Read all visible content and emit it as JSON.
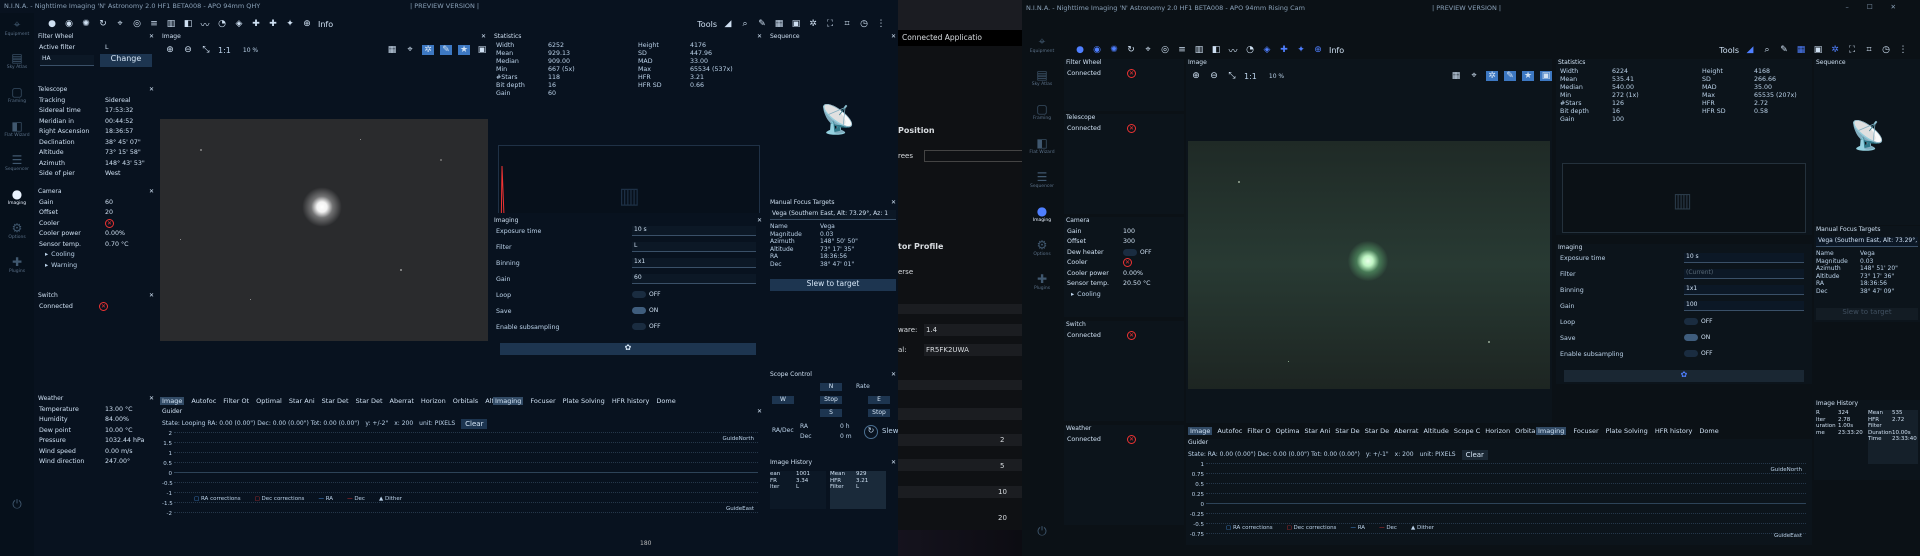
{
  "win1": {
    "title": "N.I.N.A. - Nighttime Imaging 'N' Astronomy 2.0 HF1 BETA008  -  APO 94mm QHY",
    "preview": "| PREVIEW VERSION |",
    "tools": "Tools",
    "info": "Info",
    "nav": [
      "Equipment",
      "Sky Atlas",
      "Framing",
      "Flat Wizard",
      "Sequencer",
      "Imaging",
      "Options",
      "Plugins"
    ],
    "filterwheel": {
      "title": "Filter Wheel",
      "active_label": "Active filter",
      "active_value": "L",
      "select": "HA",
      "change": "Change"
    },
    "telescope": {
      "title": "Telescope",
      "rows": [
        [
          "Tracking",
          "Sidereal"
        ],
        [
          "Sidereal time",
          "17:53:32"
        ],
        [
          "Meridian in",
          "00:44:52"
        ],
        [
          "Right Ascension",
          "18:36:57"
        ],
        [
          "Declination",
          "38° 45' 07\""
        ],
        [
          "Altitude",
          "73° 15' 58\""
        ],
        [
          "Azimuth",
          "148° 43' 53\""
        ],
        [
          "Side of pier",
          "West"
        ]
      ]
    },
    "camera": {
      "title": "Camera",
      "rows": [
        [
          "Gain",
          "60"
        ],
        [
          "Offset",
          "20"
        ],
        [
          "Cooler",
          ""
        ],
        [
          "Cooler power",
          "0.00%"
        ],
        [
          "Sensor temp.",
          "0.70 °C"
        ]
      ],
      "sub1": "Cooling",
      "sub2": "Warning"
    },
    "switch": {
      "title": "Switch",
      "connected": "Connected"
    },
    "weather": {
      "title": "Weather",
      "rows": [
        [
          "Temperature",
          "13.00 °C"
        ],
        [
          "Humidity",
          "84.00%"
        ],
        [
          "Dew point",
          "10.00 °C"
        ],
        [
          "Pressure",
          "1032.44 hPa"
        ],
        [
          "Wind speed",
          "0.00 m/s"
        ],
        [
          "Wind direction",
          "247.00°"
        ]
      ]
    },
    "image": {
      "title": "Image",
      "zoom": "10 %",
      "fit": "1:1"
    },
    "stats": {
      "title": "Statistics",
      "cells": [
        "Width",
        "6252",
        "Height",
        "4176",
        "Mean",
        "929.13",
        "SD",
        "447.96",
        "Median",
        "909.00",
        "MAD",
        "33.00",
        "Min",
        "667 (5x)",
        "Max",
        "65534 (537x)",
        "#Stars",
        "118",
        "HFR",
        "3.21",
        "Bit depth",
        "16",
        "HFR SD",
        "0.66",
        "Gain",
        "60",
        "",
        ""
      ]
    },
    "imaging": {
      "title": "Imaging",
      "rows": [
        [
          "Exposure time",
          "10 s"
        ],
        [
          "Filter",
          "L"
        ],
        [
          "Binning",
          "1x1"
        ],
        [
          "Gain",
          "60"
        ]
      ],
      "loop": [
        "Loop",
        "OFF"
      ],
      "save": [
        "Save",
        "ON"
      ],
      "sub": [
        "Enable subsampling",
        "OFF"
      ]
    },
    "sequence": {
      "title": "Sequence"
    },
    "mft": {
      "title": "Manual Focus Targets",
      "select": "Vega (Southern East, Alt: 73.29°, Az: 1",
      "rows": [
        [
          "Name",
          "Vega"
        ],
        [
          "Magnitude",
          "0.03"
        ],
        [
          "Azimuth",
          "148° 50' 50\""
        ],
        [
          "Altitude",
          "73° 17' 35\""
        ],
        [
          "RA",
          "18:36:56"
        ],
        [
          "Dec",
          "38° 47' 01\""
        ]
      ],
      "slew": "Slew to target"
    },
    "scope": {
      "title": "Scope Control",
      "n": "N",
      "rate": "Rate",
      "w": "W",
      "stop": "Stop",
      "e": "E",
      "s": "S",
      "radec": "RA/Dec",
      "ra": "RA",
      "dec": "Dec",
      "h": "0 h",
      "m": "0 m",
      "slew": "Slew"
    },
    "history": {
      "title": "Image History",
      "a": [
        "ean",
        "FR",
        "lter"
      ],
      "av": [
        "1001",
        "3.34",
        "L"
      ],
      "b": [
        "Mean",
        "HFR",
        "Filter"
      ],
      "bv": [
        "929",
        "3.21",
        "L"
      ]
    },
    "tabs_left": [
      "Image",
      "Autofoc",
      "Filter Ot",
      "Optimal",
      "Star Ani",
      "Star Det",
      "Star Det",
      "Aberrat",
      "Horizon",
      "Orbitals",
      "Altitude"
    ],
    "tabs_right": [
      "Imaging",
      "Focuser",
      "Plate Solving",
      "HFR history",
      "Dome"
    ],
    "guider": {
      "title": "Guider",
      "state": "State: Looping  RA: 0.00 (0.00\")  Dec: 0.00 (0.00\")  Tot: 0.00 (0.00\")",
      "y": "y: +/-2\"",
      "x": "x: 200",
      "unit": "unit: PIXELS",
      "clear": "Clear",
      "north": "GuideNorth",
      "east": "GuideEast",
      "yticks": [
        "2",
        "1.5",
        "1",
        "0.5",
        "0",
        "-0.5",
        "-1",
        "-1.5",
        "-2"
      ],
      "legend": [
        "RA corrections",
        "Dec corrections",
        "RA",
        "Dec",
        "Dither"
      ]
    }
  },
  "middle": {
    "title": "Connected Applicatio",
    "position": "Position",
    "degrees": "rees",
    "profile": "tor Profile",
    "verse": "erse",
    "ware_k": "ware:",
    "ware_v": "1.4",
    "al_k": "al:",
    "al_v": "FR5FK2UWA",
    "nums": [
      "2",
      "5",
      "10",
      "20"
    ],
    "bottom": "180"
  },
  "win2": {
    "title": "N.I.N.A. - Nighttime Imaging 'N' Astronomy 2.0 HF1 BETA008  -  APO 94mm Rising Cam",
    "preview": "| PREVIEW VERSION |",
    "tools": "Tools",
    "info": "Info",
    "nav": [
      "Equipment",
      "Sky Atlas",
      "Framing",
      "Flat Wizard",
      "Sequencer",
      "Imaging",
      "Options",
      "Plugins"
    ],
    "filterwheel": {
      "title": "Filter Wheel",
      "connected": "Connected"
    },
    "telescope": {
      "title": "Telescope",
      "connected": "Connected"
    },
    "camera": {
      "title": "Camera",
      "rows": [
        [
          "Gain",
          "100"
        ],
        [
          "Offset",
          "300"
        ],
        [
          "Dew heater",
          "OFF"
        ],
        [
          "Cooler",
          ""
        ],
        [
          "Cooler power",
          "0.00%"
        ],
        [
          "Sensor temp.",
          "20.50 °C"
        ]
      ],
      "sub1": "Cooling"
    },
    "switch": {
      "title": "Switch",
      "connected": "Connected"
    },
    "weather": {
      "title": "Weather",
      "connected": "Connected"
    },
    "image": {
      "title": "Image",
      "zoom": "10 %",
      "fit": "1:1"
    },
    "stats": {
      "title": "Statistics",
      "cells": [
        "Width",
        "6224",
        "Height",
        "4168",
        "Mean",
        "535.41",
        "SD",
        "266.66",
        "Median",
        "540.00",
        "MAD",
        "35.00",
        "Min",
        "272 (1x)",
        "Max",
        "65535 (207x)",
        "#Stars",
        "126",
        "HFR",
        "2.72",
        "Bit depth",
        "16",
        "HFR SD",
        "0.58",
        "Gain",
        "100",
        "",
        ""
      ]
    },
    "imaging": {
      "title": "Imaging",
      "rows": [
        [
          "Exposure time",
          "10 s"
        ],
        [
          "Filter",
          "(Current)"
        ],
        [
          "Binning",
          "1x1"
        ],
        [
          "Gain",
          "100"
        ]
      ],
      "loop": [
        "Loop",
        "OFF"
      ],
      "save": [
        "Save",
        "ON"
      ],
      "sub": [
        "Enable subsampling",
        "OFF"
      ]
    },
    "sequence": {
      "title": "Sequence"
    },
    "mft": {
      "title": "Manual Focus Targets",
      "select": "Vega (Southern East, Alt: 73.29°, Az: 1",
      "rows": [
        [
          "Name",
          "Vega"
        ],
        [
          "Magnitude",
          "0.03"
        ],
        [
          "Azimuth",
          "148° 51' 20\""
        ],
        [
          "Altitude",
          "73° 17' 36\""
        ],
        [
          "RA",
          "18:36:56"
        ],
        [
          "Dec",
          "38° 47' 09\""
        ]
      ],
      "slew": "Slew to target"
    },
    "history": {
      "title": "Image History",
      "a": [
        "R",
        "lter",
        "uration",
        "me"
      ],
      "av": [
        "324",
        "2.78",
        "1.00s",
        "23:33:20"
      ],
      "b": [
        "Mean",
        "HFR",
        "Filter",
        "Duration",
        "Time"
      ],
      "bv": [
        "535",
        "2.72",
        "",
        "10.00s",
        "23:33:40"
      ]
    },
    "tabs_left": [
      "Image",
      "Autofoc",
      "Filter O",
      "Optima",
      "Star Ani",
      "Star De",
      "Star De",
      "Aberrat",
      "Altitude",
      "Scope C",
      "Horizon",
      "Orbitals"
    ],
    "tabs_right": [
      "Imaging",
      "Focuser",
      "Plate Solving",
      "HFR history",
      "Dome"
    ],
    "guider": {
      "title": "Guider",
      "state": "State:  RA: 0.00 (0.00\")  Dec: 0.00 (0.00\")  Tot: 0.00 (0.00\")",
      "y": "y: +/-1\"",
      "x": "x: 200",
      "unit": "unit: PIXELS",
      "clear": "Clear",
      "north": "GuideNorth",
      "east": "GuideEast",
      "yticks": [
        "1",
        "0.75",
        "0.5",
        "0.25",
        "0",
        "-0.25",
        "-0.5",
        "-0.75",
        "-1"
      ],
      "legend": [
        "RA corrections",
        "Dec corrections",
        "RA",
        "Dec",
        "Dither"
      ]
    }
  },
  "colors": {
    "bg1": "#08121f",
    "bg2": "#0c141b",
    "accent": "#4fa3ff",
    "red": "#e33333"
  }
}
